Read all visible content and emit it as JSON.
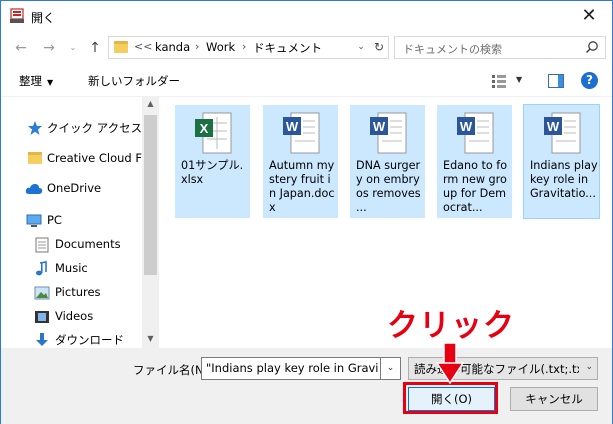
{
  "window": {
    "title": "開く"
  },
  "address": {
    "overflow": "<<",
    "crumbs": [
      "kanda",
      "Work",
      "ドキュメント"
    ]
  },
  "search": {
    "placeholder": "ドキュメントの検索"
  },
  "toolbar": {
    "organize": "整理",
    "new_folder": "新しいフォルダー"
  },
  "sidebar": {
    "items": [
      {
        "label": "クイック アクセス",
        "icon": "star-icon"
      },
      {
        "label": "Creative Cloud Files",
        "icon": "folder-icon"
      },
      {
        "label": "OneDrive",
        "icon": "cloud-icon"
      },
      {
        "label": "PC",
        "icon": "computer-icon"
      },
      {
        "label": "Documents",
        "icon": "documents-icon"
      },
      {
        "label": "Music",
        "icon": "music-icon"
      },
      {
        "label": "Pictures",
        "icon": "pictures-icon"
      },
      {
        "label": "Videos",
        "icon": "videos-icon"
      },
      {
        "label": "ダウンロード",
        "icon": "download-icon"
      }
    ]
  },
  "files": [
    {
      "name": "01サンプル.xlsx",
      "type": "excel"
    },
    {
      "name": "Autumn mystery fruit in Japan.docx",
      "type": "word"
    },
    {
      "name": "DNA surgery on embryos removes ...",
      "type": "word"
    },
    {
      "name": "Edano to form new group for Democrat...",
      "type": "word"
    },
    {
      "name": "Indians play key role in Gravitatio...",
      "type": "word"
    }
  ],
  "bottom": {
    "filename_label": "ファイル名(N):",
    "filename_value": "\"Indians play key role in Gravitat",
    "filetype_value": "読み込み可能なファイル(.txt;.txt;.a",
    "open_label": "開く(O)",
    "cancel_label": "キャンセル"
  },
  "annotation": {
    "text": "クリック",
    "color": "#e60012"
  },
  "colors": {
    "selection": "#cce8ff",
    "accent": "#0078d7"
  }
}
